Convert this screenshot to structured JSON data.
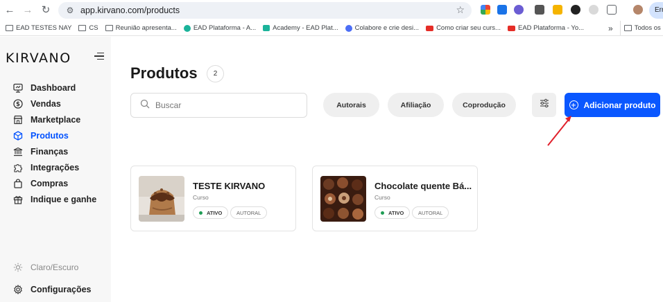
{
  "browser": {
    "url": "app.kirvano.com/products",
    "profile_text": "Err",
    "bookmarks": [
      {
        "label": "EAD TESTES NAY",
        "icon": "folder-icon"
      },
      {
        "label": "CS",
        "icon": "folder-icon"
      },
      {
        "label": "Reunião apresenta...",
        "icon": "folder-icon"
      },
      {
        "label": "EAD Plataforma - A...",
        "icon": "site-icon"
      },
      {
        "label": "Academy - EAD Plat...",
        "icon": "site-icon"
      },
      {
        "label": "Colabore e crie desi...",
        "icon": "site-icon"
      },
      {
        "label": "Como criar seu curs...",
        "icon": "youtube-icon"
      },
      {
        "label": "EAD Plataforma - Yo...",
        "icon": "youtube-icon"
      },
      {
        "label": "»",
        "icon": ""
      },
      {
        "label": "Todos os marcad",
        "icon": "folder-icon"
      }
    ]
  },
  "sidebar": {
    "logo": "KIRVANO",
    "items": [
      {
        "label": "Dashboard",
        "icon": "dashboard-icon",
        "active": false
      },
      {
        "label": "Vendas",
        "icon": "dollar-icon",
        "active": false
      },
      {
        "label": "Marketplace",
        "icon": "store-icon",
        "active": false
      },
      {
        "label": "Produtos",
        "icon": "box-icon",
        "active": true
      },
      {
        "label": "Finanças",
        "icon": "bank-icon",
        "active": false
      },
      {
        "label": "Integrações",
        "icon": "puzzle-icon",
        "active": false
      },
      {
        "label": "Compras",
        "icon": "bag-icon",
        "active": false
      },
      {
        "label": "Indique e ganhe",
        "icon": "gift-icon",
        "active": false
      }
    ],
    "theme_toggle": "Claro/Escuro",
    "settings": "Configurações"
  },
  "main": {
    "title": "Produtos",
    "count": "2",
    "search_placeholder": "Buscar",
    "filters": [
      "Autorais",
      "Afiliação",
      "Coprodução"
    ],
    "add_button": "Adicionar produto",
    "products": [
      {
        "title": "TESTE KIRVANO",
        "type": "Curso",
        "status": "ATIVO",
        "kind": "AUTORAL"
      },
      {
        "title": "Chocolate quente Bá...",
        "type": "Curso",
        "status": "ATIVO",
        "kind": "AUTORAL"
      }
    ]
  },
  "colors": {
    "accent": "#0a57ff",
    "active_nav": "#0051ff",
    "status_dot": "#1f9d55",
    "annotation_arrow": "#e0202b"
  }
}
